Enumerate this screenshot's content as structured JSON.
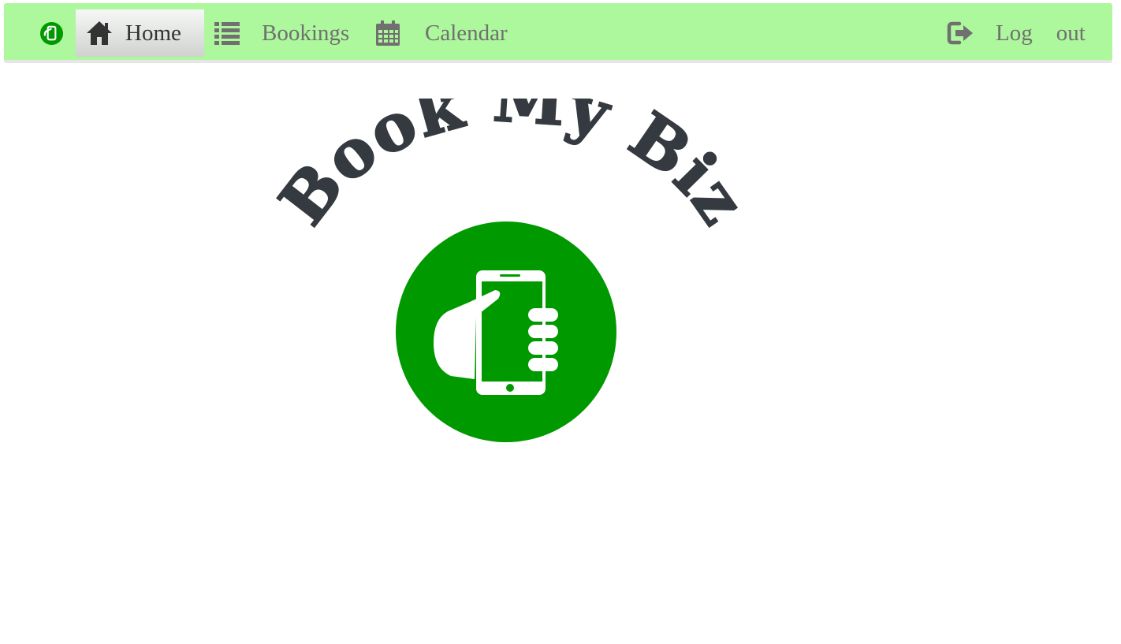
{
  "navbar": {
    "brand_icon": "brand-phone-hand-icon",
    "items": [
      {
        "label": "Home",
        "icon": "home-icon",
        "active": true
      },
      {
        "label": "Bookings",
        "icon": "list-icon",
        "active": false
      },
      {
        "label": "Calendar",
        "icon": "calendar-icon",
        "active": false
      }
    ],
    "logout": {
      "icon": "sign-out-icon",
      "word1": "Log",
      "word2": "out"
    }
  },
  "hero": {
    "logo_text": "Book My Biz",
    "logo_icon": "hand-holding-phone-icon"
  },
  "colors": {
    "navbar_bg": "#adf79d",
    "brand_green": "#009900",
    "logo_text": "#343a40",
    "nav_text": "#707070",
    "active_text": "#333333"
  }
}
